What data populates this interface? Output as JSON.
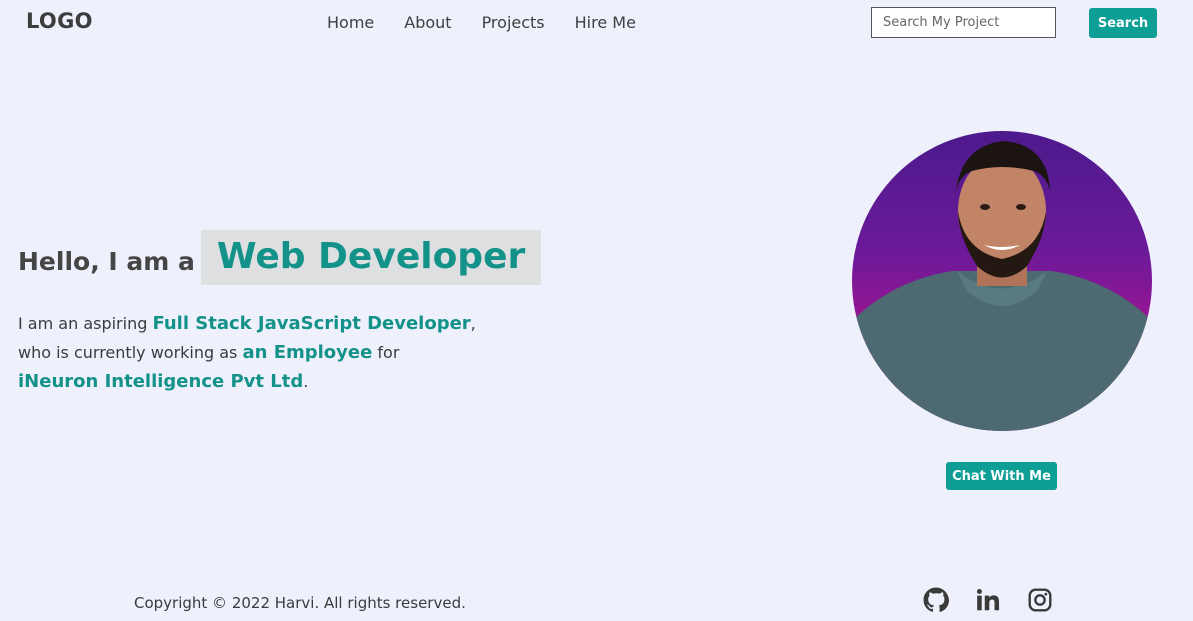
{
  "header": {
    "logo": "LOGO",
    "nav": [
      {
        "label": "Home"
      },
      {
        "label": "About"
      },
      {
        "label": "Projects"
      },
      {
        "label": "Hire Me"
      }
    ],
    "search": {
      "placeholder": "Search My Project",
      "button_label": "Search"
    }
  },
  "hero": {
    "greeting": "Hello, I am a",
    "role": "Web Developer",
    "about": {
      "part1": "I am an aspiring ",
      "highlight1": "Full Stack JavaScript Developer",
      "part2": ",",
      "part3": "who is currently working as ",
      "highlight2": "an Employee",
      "part4": " for",
      "highlight3": "iNeuron Intelligence Pvt Ltd",
      "part5": "."
    },
    "chat_button": "Chat With Me"
  },
  "footer": {
    "copyright": "Copyright © 2022 Harvi. All rights reserved.",
    "social": [
      "github-icon",
      "linkedin-icon",
      "instagram-icon"
    ]
  },
  "colors": {
    "accent": "#0d9e96",
    "background": "#eef1fc",
    "role_bg": "#dedfe0"
  }
}
